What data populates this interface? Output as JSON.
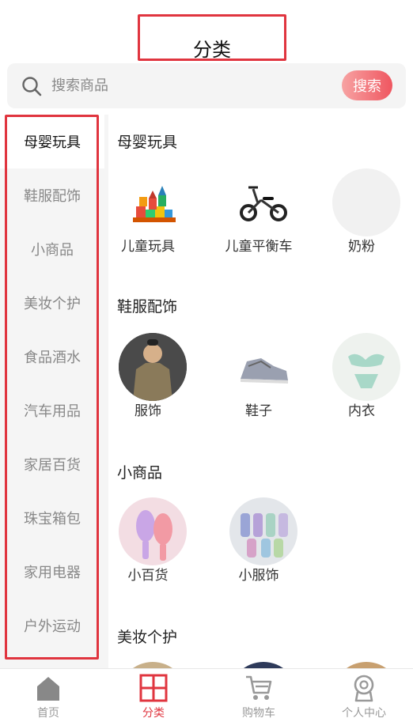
{
  "header": {
    "title": "分类"
  },
  "search": {
    "placeholder": "搜索商品",
    "button_label": "搜索"
  },
  "sidebar": {
    "items": [
      {
        "label": "母婴玩具",
        "active": true
      },
      {
        "label": "鞋服配饰"
      },
      {
        "label": "小商品"
      },
      {
        "label": "美妆个护"
      },
      {
        "label": "食品酒水"
      },
      {
        "label": "汽车用品"
      },
      {
        "label": "家居百货"
      },
      {
        "label": "珠宝箱包"
      },
      {
        "label": "家用电器"
      },
      {
        "label": "户外运动"
      }
    ]
  },
  "sections": [
    {
      "title": "母婴玩具",
      "items": [
        {
          "label": "儿童玩具",
          "icon": "toy-blocks-image"
        },
        {
          "label": "儿童平衡车",
          "icon": "balance-bike-image"
        },
        {
          "label": "奶粉",
          "icon": "milk-powder-image"
        }
      ]
    },
    {
      "title": "鞋服配饰",
      "items": [
        {
          "label": "服饰",
          "icon": "shirt-image"
        },
        {
          "label": "鞋子",
          "icon": "sneaker-image"
        },
        {
          "label": "内衣",
          "icon": "lingerie-image"
        }
      ]
    },
    {
      "title": "小商品",
      "items": [
        {
          "label": "小百货",
          "icon": "hairbrush-image"
        },
        {
          "label": "小服饰",
          "icon": "socks-image"
        }
      ]
    },
    {
      "title": "美妆个护",
      "items": []
    }
  ],
  "tabbar": {
    "items": [
      {
        "label": "首页",
        "icon": "home-icon"
      },
      {
        "label": "分类",
        "icon": "category-icon",
        "active": true
      },
      {
        "label": "购物车",
        "icon": "cart-icon"
      },
      {
        "label": "个人中心",
        "icon": "profile-icon"
      }
    ]
  },
  "colors": {
    "accent": "#e0353f",
    "search_gradient_start": "#f7a3a3",
    "search_gradient_end": "#ef5660",
    "sidebar_bg": "#f5f5f5"
  }
}
